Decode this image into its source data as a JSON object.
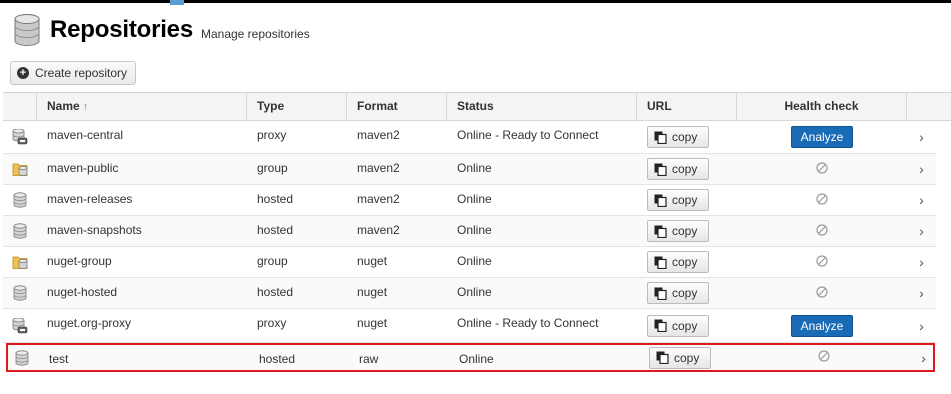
{
  "page": {
    "title": "Repositories",
    "subtitle": "Manage repositories",
    "create_button": "Create repository"
  },
  "table": {
    "columns": {
      "name": "Name",
      "type": "Type",
      "format": "Format",
      "status": "Status",
      "url": "URL",
      "health": "Health check"
    },
    "sort_indicator": "↑",
    "copy_label": "copy",
    "analyze_label": "Analyze",
    "chevron": "›",
    "rows": [
      {
        "name": "maven-central",
        "type": "proxy",
        "format": "maven2",
        "status": "Online - Ready to Connect",
        "icon": "proxy-repo-icon",
        "health": "analyze"
      },
      {
        "name": "maven-public",
        "type": "group",
        "format": "maven2",
        "status": "Online",
        "icon": "group-repo-icon",
        "health": "disabled"
      },
      {
        "name": "maven-releases",
        "type": "hosted",
        "format": "maven2",
        "status": "Online",
        "icon": "hosted-repo-icon",
        "health": "disabled"
      },
      {
        "name": "maven-snapshots",
        "type": "hosted",
        "format": "maven2",
        "status": "Online",
        "icon": "hosted-repo-icon",
        "health": "disabled"
      },
      {
        "name": "nuget-group",
        "type": "group",
        "format": "nuget",
        "status": "Online",
        "icon": "group-repo-icon",
        "health": "disabled"
      },
      {
        "name": "nuget-hosted",
        "type": "hosted",
        "format": "nuget",
        "status": "Online",
        "icon": "hosted-repo-icon",
        "health": "disabled"
      },
      {
        "name": "nuget.org-proxy",
        "type": "proxy",
        "format": "nuget",
        "status": "Online - Ready to Connect",
        "icon": "proxy-repo-icon",
        "health": "analyze"
      },
      {
        "name": "test",
        "type": "hosted",
        "format": "raw",
        "status": "Online",
        "icon": "hosted-repo-icon",
        "health": "disabled",
        "highlighted": true
      }
    ]
  },
  "colors": {
    "accent": "#1a6bb5",
    "highlight_border": "#e0171d"
  }
}
